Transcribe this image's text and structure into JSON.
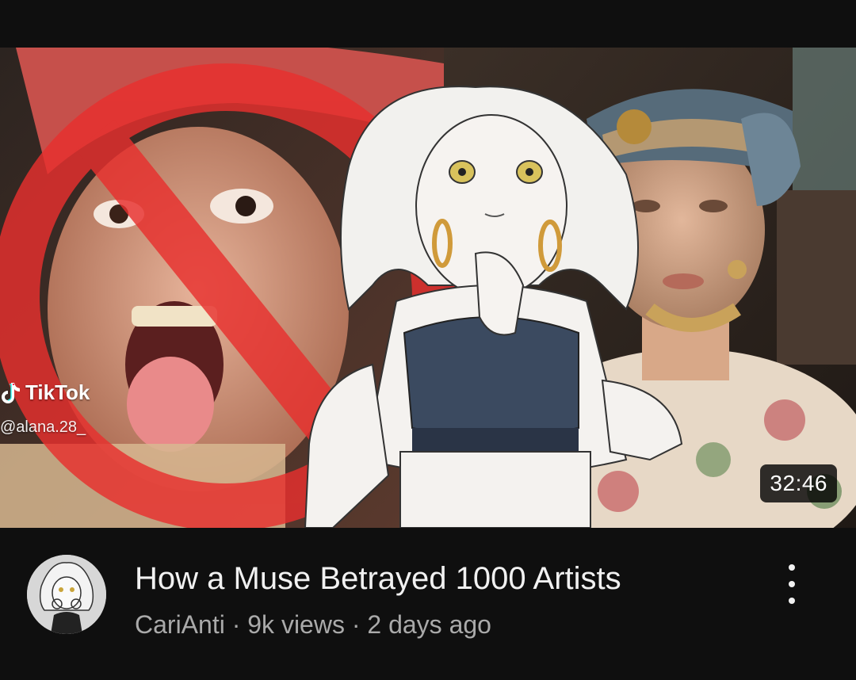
{
  "video": {
    "title": "How a Muse Betrayed 1000 Artists",
    "channel": "CariAnti",
    "views": "9k views",
    "age": "2 days ago",
    "separator": " · ",
    "duration": "32:46",
    "menu_icon": "more-vert-icon"
  },
  "thumbnail": {
    "watermark_brand": "TikTok",
    "watermark_handle": "@alana.28_",
    "prohibition_color": "#e8302e"
  },
  "colors": {
    "background": "#0f0f0f",
    "title": "#f1f1f1",
    "subtitle": "#aaaaaa"
  }
}
